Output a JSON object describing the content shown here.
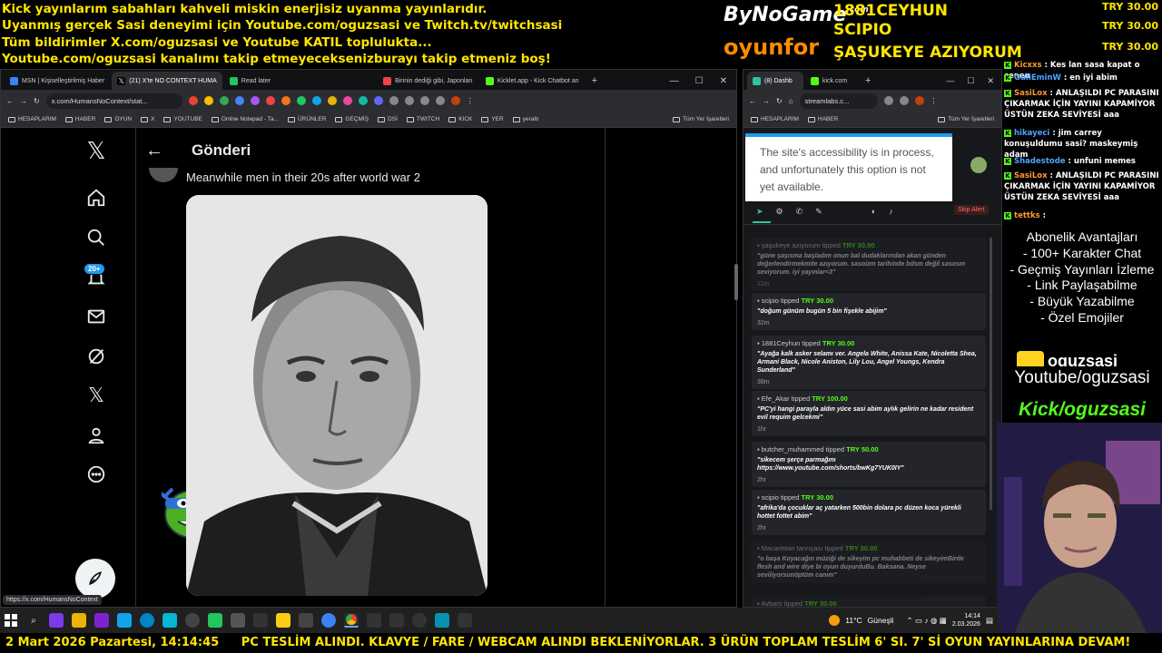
{
  "banner": {
    "line1": "Kick yayınlarım sabahları kahveli miskin enerjisiz uyanma yayınlarıdır.",
    "line2": "Uyanmış gerçek Sasi deneyimi için Youtube.com/oguzsasi ve Twitch.tv/twitchsasi",
    "line3": "Tüm bildirimler X.com/oguzsasi ve Youtube KATIL toplulukta...",
    "line4": "Youtube.com/oguzsasi kanalımı takip etmeyeceksenizburayı takip etmeniz boş!"
  },
  "sponsors": {
    "bynogame": "ByNoGame",
    "bynogame_com": ".com",
    "oyunfor": "oyunfor"
  },
  "top_donors": {
    "name1": "1881CEYHUN",
    "name2": "SCIPIO",
    "msg": "ŞAŞUKEYE AZIYORUM",
    "amt1": "TRY 30.00",
    "amt2": "TRY 30.00",
    "amt3": "TRY 30.00"
  },
  "left_browser": {
    "tabs": [
      "MSN | Kişiselleştirilmiş Haber",
      "(21) X'te NO CONTEXT HUMA",
      "Read later",
      "Birinin dediği gibi, Japonları",
      "Kicklet.app - Kick Chatbot an"
    ],
    "url": "x.com/HumansNoContext/stat...",
    "bookmarks": [
      "HESAPLARIM",
      "HABER",
      "OYUN",
      "X",
      "YOUTUBE",
      "Online Notepad - Ta...",
      "ÜRÜNLER",
      "GEÇMİŞ",
      "DSİ",
      "TWITCH",
      "KICK",
      "YER",
      "yeraltı"
    ],
    "bookmarks_all": "Tüm Yer İşaretleri",
    "status_url": "https://x.com/HumansNoContext"
  },
  "x": {
    "header_title": "Gönderi",
    "post_text": "Meanwhile men in their 20s after world war 2",
    "notif_badge": "20+"
  },
  "right_browser": {
    "tabs": [
      "(8) Dashb",
      "kick.com"
    ],
    "url": "streamlabs.c...",
    "bookmarks": [
      "HESAPLARIM",
      "HABER"
    ],
    "bookmarks_all": "Tüm Yer İşaretleri",
    "alert": "The site's accessibility is in process, and unfortunately this option is not yet available.",
    "skip_alert": "Skip Alert",
    "tips": [
      {
        "user": "şaşukeye azıyorum",
        "amount": "TRY 30.00",
        "msg": "\"güne şaşısma başladım onun bal dudaklarından akan günden değerlendirmekmite azıyorum. sasoizm tarihinde bdsm değil sasosm seviyorum. iyi yayınlar<3\"",
        "ago": "12m",
        "dim": true
      },
      {
        "user": "scipio",
        "amount": "TRY 30.00",
        "msg": "\"doğum günüm bugün 5 bin fişekle abijim\"",
        "ago": "32m",
        "dim": false
      },
      {
        "user": "1881Ceyhun",
        "amount": "TRY 30.00",
        "msg": "\"Ayağa kalk asker selamı ver. Angela White, Anissa Kate, Nicoletta Shea, Armani Black, Nicole Aniston, Lily Lou, Angel Youngs, Kendra Sunderland\"",
        "ago": "38m",
        "dim": false
      },
      {
        "user": "Efe_Akar",
        "amount": "TRY 100.00",
        "msg": "\"PC'yi hangi parayla aldın yüce sasi abim aylık gelirin ne kadar resident evil requim gelcekmi\"",
        "ago": "1hr",
        "dim": false
      },
      {
        "user": "butcher_muhammed",
        "amount": "TRY 50.00",
        "msg": "\"sikecem şerçe parmağını https://www.youtube.com/shorts/bwKg7YUK0IY\"",
        "ago": "2hr",
        "dim": false
      },
      {
        "user": "scipio",
        "amount": "TRY 30.00",
        "msg": "\"afrika'da çocuklar aç yatarken 500bin dolara pc düzen koca yürekli hottet fottet abim\"",
        "ago": "2hr",
        "dim": false
      },
      {
        "user": "Macaristan tanrıçası",
        "amount": "TRY 30.00",
        "msg": "\"o başa Koyacağın müziği de sikeyim pc muhabbeti de sikeyimBirde flesh and wire diye bi oyun duyurduBu. Baksana. Neyse seviliyorsunöptüm canım\"",
        "ago": "",
        "dim": true
      },
      {
        "user": "Avbars",
        "amount": "TRY 30.00",
        "msg": "",
        "ago": "",
        "dim": true
      }
    ]
  },
  "chat": [
    {
      "user": "Kicxxs",
      "text": "Kes lan sasa kapat o çenen"
    },
    {
      "user": "GuliEminW",
      "text": "en iyi abim"
    },
    {
      "user": "SasiLox",
      "text": "ANLAŞILDI PC PARASINI ÇIKARMAK İÇİN YAYINI KAPAMİYOR ÜSTÜN ZEKA SEVİYESİ aaa"
    },
    {
      "user": "hikayeci",
      "text": "jim carrey konuşuldumu sasi? maskeymiş adam"
    },
    {
      "user": "Shadestode",
      "text": "unfuni memes"
    },
    {
      "user": "SasiLox",
      "text": "ANLAŞILDI PC PARASINI ÇIKARMAK İÇİN YAYINI KAPAMİYOR ÜSTÜN ZEKA SEVİYESİ aaa"
    },
    {
      "user": "tettks",
      "text": ""
    }
  ],
  "perks": {
    "title": "Abonelik Avantajları",
    "items": [
      "- 100+ Karakter Chat",
      "- Geçmiş Yayınları İzleme",
      "- Link Paylaşabilme",
      "- Büyük Yazabilme",
      "- Özel Emojiler"
    ]
  },
  "socials": {
    "brand": "oguzsasi",
    "youtube": "Youtube/oguzsasi",
    "kick": "Kick/oguzsasi"
  },
  "taskbar": {
    "weather": "11°C",
    "weather_label": "Güneşli",
    "time": "14:14",
    "date": "2.03.2026"
  },
  "footer": {
    "datetime": "2 Mart 2026 Pazartesi, 14:14:45",
    "ticker": "PC TESLİM ALINDI. KLAVYE / FARE / WEBCAM ALINDI BEKLENİYORLAR. 3 ÜRÜN TOPLAM TESLİM 6' SI. 7' Sİ OYUN YAYINLARINA DEVAM!"
  }
}
